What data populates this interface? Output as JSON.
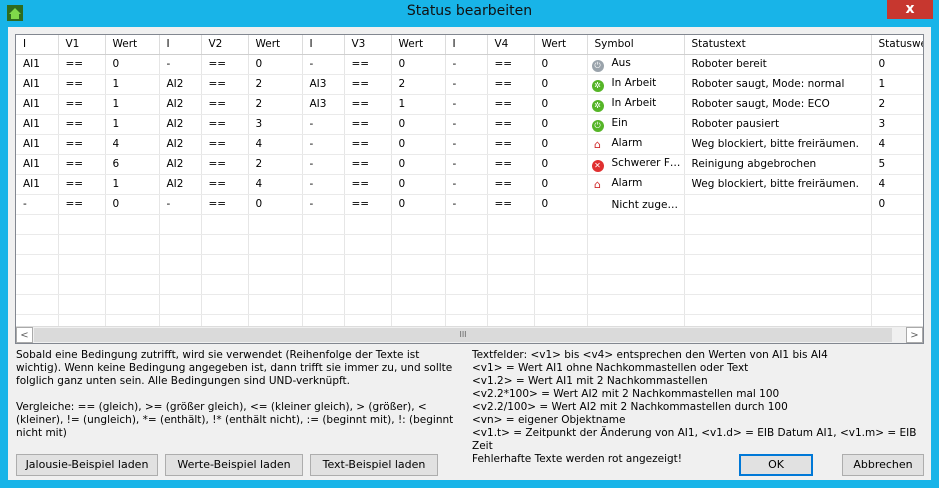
{
  "window": {
    "title": "Status bearbeiten",
    "close_label": "x"
  },
  "columns": [
    "I",
    "V1",
    "Wert",
    "I",
    "V2",
    "Wert",
    "I",
    "V3",
    "Wert",
    "I",
    "V4",
    "Wert",
    "Symbol",
    "Statustext",
    "Statuswert"
  ],
  "rows": [
    {
      "cells": [
        "AI1",
        "==",
        "0",
        "-",
        "==",
        "0",
        "-",
        "==",
        "0",
        "-",
        "==",
        "0"
      ],
      "icon": "power-icon",
      "icon_color": "#9aa3ab",
      "symbol": "Aus",
      "statustext": "Roboter bereit",
      "statuswert": "0"
    },
    {
      "cells": [
        "AI1",
        "==",
        "1",
        "AI2",
        "==",
        "2",
        "AI3",
        "==",
        "2",
        "-",
        "==",
        "0"
      ],
      "icon": "gear-icon",
      "icon_color": "#56b528",
      "symbol": "In Arbeit",
      "statustext": "Roboter saugt, Mode: normal",
      "statuswert": "1"
    },
    {
      "cells": [
        "AI1",
        "==",
        "1",
        "AI2",
        "==",
        "2",
        "AI3",
        "==",
        "1",
        "-",
        "==",
        "0"
      ],
      "icon": "gear-icon",
      "icon_color": "#56b528",
      "symbol": "In Arbeit",
      "statustext": "Roboter saugt, Mode: ECO",
      "statuswert": "2"
    },
    {
      "cells": [
        "AI1",
        "==",
        "1",
        "AI2",
        "==",
        "3",
        "-",
        "==",
        "0",
        "-",
        "==",
        "0"
      ],
      "icon": "power-icon",
      "icon_color": "#56b528",
      "symbol": "Ein",
      "statustext": "Roboter pausiert",
      "statuswert": "3"
    },
    {
      "cells": [
        "AI1",
        "==",
        "4",
        "AI2",
        "==",
        "4",
        "-",
        "==",
        "0",
        "-",
        "==",
        "0"
      ],
      "icon": "alarm-house-icon",
      "icon_color": "#d12a2a",
      "symbol": "Alarm",
      "statustext": "Weg blockiert, bitte freiräumen.",
      "statuswert": "4"
    },
    {
      "cells": [
        "AI1",
        "==",
        "6",
        "AI2",
        "==",
        "2",
        "-",
        "==",
        "0",
        "-",
        "==",
        "0"
      ],
      "icon": "error-x-icon",
      "icon_color": "#e03030",
      "symbol": "Schwerer F…",
      "statustext": "Reinigung abgebrochen",
      "statuswert": "5"
    },
    {
      "cells": [
        "AI1",
        "==",
        "1",
        "AI2",
        "==",
        "4",
        "-",
        "==",
        "0",
        "-",
        "==",
        "0"
      ],
      "icon": "alarm-house-icon",
      "icon_color": "#d12a2a",
      "symbol": "Alarm",
      "statustext": "Weg blockiert, bitte freiräumen.",
      "statuswert": "4"
    },
    {
      "cells": [
        "-",
        "==",
        "0",
        "-",
        "==",
        "0",
        "-",
        "==",
        "0",
        "-",
        "==",
        "0"
      ],
      "icon": "",
      "icon_color": "",
      "symbol": "Nicht zuge…",
      "statustext": "",
      "statuswert": "0"
    }
  ],
  "help_left": "Sobald eine Bedingung zutrifft, wird sie verwendet (Reihenfolge der Texte ist wichtig). Wenn keine Bedingung angegeben ist, dann trifft sie immer zu, und sollte folglich ganz unten sein. Alle Bedingungen sind UND-verknüpft.\n\nVergleiche: == (gleich), >= (größer gleich), <= (kleiner gleich), > (größer), < (kleiner), != (ungleich), *= (enthält), !* (enthält nicht), := (beginnt mit), !: (beginnt nicht mit)",
  "help_right": "Textfelder: <v1> bis <v4> entsprechen den Werten von AI1 bis AI4\n<v1> = Wert AI1 ohne Nachkommastellen oder Text\n<v1.2> = Wert AI1 mit 2 Nachkommastellen\n<v2.2*100> = Wert AI2 mit 2 Nachkommastellen mal 100\n<v2.2/100> = Wert AI2 mit 2 Nachkommastellen durch 100\n<vn> = eigener Objektname\n<v1.t> = Zeitpunkt der Änderung von AI1, <v1.d> = EIB Datum AI1, <v1.m> = EIB Zeit\nFehlerhafte Texte werden rot angezeigt!",
  "buttons": {
    "jalousie": "Jalousie-Beispiel laden",
    "werte": "Werte-Beispiel laden",
    "text": "Text-Beispiel laden",
    "ok": "OK",
    "cancel": "Abbrechen"
  },
  "scrollbar": {
    "left": "<",
    "right": ">",
    "thumb": "III"
  }
}
